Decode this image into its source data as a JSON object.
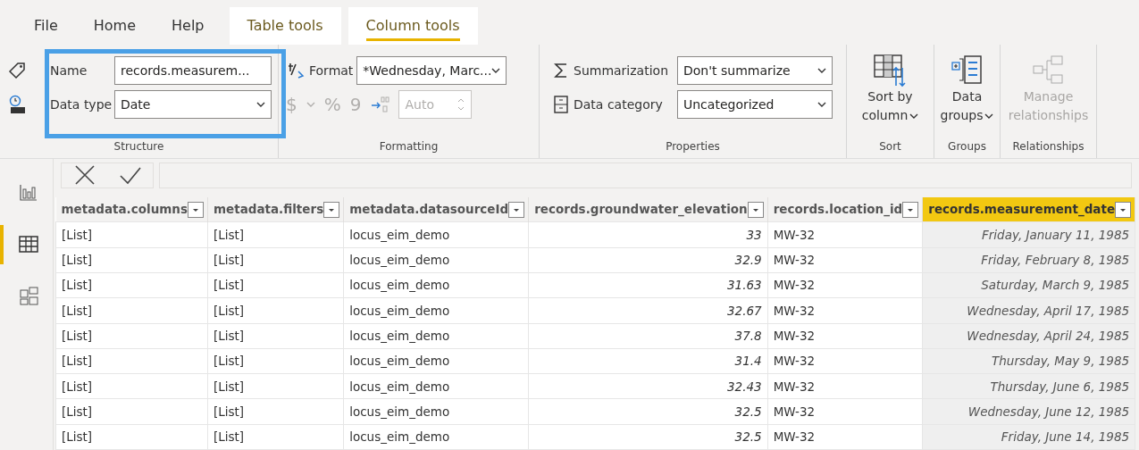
{
  "tabs": [
    {
      "label": "File",
      "contextual": false,
      "selected": false
    },
    {
      "label": "Home",
      "contextual": false,
      "selected": false
    },
    {
      "label": "Help",
      "contextual": false,
      "selected": false
    },
    {
      "label": "Table tools",
      "contextual": true,
      "selected": false
    },
    {
      "label": "Column tools",
      "contextual": true,
      "selected": true
    }
  ],
  "structure": {
    "name_label": "Name",
    "name_value": "records.measurem...",
    "type_label": "Data type",
    "type_value": "Date",
    "group": "Structure",
    "highlighted": true
  },
  "formatting": {
    "format_label": "Format",
    "format_value": "*Wednesday, Marc...",
    "currency": "$",
    "percent": "%",
    "comma": "9",
    "decimals_placeholder": "Auto",
    "disabled": true,
    "group": "Formatting"
  },
  "properties": {
    "summarization_label": "Summarization",
    "summarization_value": "Don't summarize",
    "category_label": "Data category",
    "category_value": "Uncategorized",
    "group": "Properties"
  },
  "big_buttons": [
    {
      "kind": "sort",
      "lines": [
        "Sort by",
        "column"
      ],
      "dropdown": true,
      "disabled": false,
      "group": "Sort"
    },
    {
      "kind": "groups",
      "lines": [
        "Data",
        "groups"
      ],
      "dropdown": true,
      "disabled": false,
      "group": "Groups"
    },
    {
      "kind": "relationships",
      "lines": [
        "Manage",
        "relationships"
      ],
      "dropdown": false,
      "disabled": true,
      "group": "Relationships"
    }
  ],
  "sidebar": [
    {
      "kind": "report",
      "selected": false
    },
    {
      "kind": "data",
      "selected": true
    },
    {
      "kind": "model",
      "selected": false
    }
  ],
  "table": {
    "columns": [
      {
        "label": "metadata.columns",
        "kind": "text",
        "selected": false
      },
      {
        "label": "metadata.filters",
        "kind": "text",
        "selected": false
      },
      {
        "label": "metadata.datasourceId",
        "kind": "text",
        "selected": false
      },
      {
        "label": "records.groundwater_elevation",
        "kind": "number",
        "selected": false
      },
      {
        "label": "records.location_id",
        "kind": "text",
        "selected": false
      },
      {
        "label": "records.measurement_date",
        "kind": "date",
        "selected": true
      }
    ],
    "rows": [
      [
        "[List]",
        "[List]",
        "locus_eim_demo",
        "33",
        "MW-32",
        "Friday, January 11, 1985"
      ],
      [
        "[List]",
        "[List]",
        "locus_eim_demo",
        "32.9",
        "MW-32",
        "Friday, February 8, 1985"
      ],
      [
        "[List]",
        "[List]",
        "locus_eim_demo",
        "31.63",
        "MW-32",
        "Saturday, March 9, 1985"
      ],
      [
        "[List]",
        "[List]",
        "locus_eim_demo",
        "32.67",
        "MW-32",
        "Wednesday, April 17, 1985"
      ],
      [
        "[List]",
        "[List]",
        "locus_eim_demo",
        "37.8",
        "MW-32",
        "Wednesday, April 24, 1985"
      ],
      [
        "[List]",
        "[List]",
        "locus_eim_demo",
        "31.4",
        "MW-32",
        "Thursday, May 9, 1985"
      ],
      [
        "[List]",
        "[List]",
        "locus_eim_demo",
        "32.43",
        "MW-32",
        "Thursday, June 6, 1985"
      ],
      [
        "[List]",
        "[List]",
        "locus_eim_demo",
        "32.5",
        "MW-32",
        "Wednesday, June 12, 1985"
      ],
      [
        "[List]",
        "[List]",
        "locus_eim_demo",
        "32.5",
        "MW-32",
        "Friday, June 14, 1985"
      ]
    ]
  }
}
